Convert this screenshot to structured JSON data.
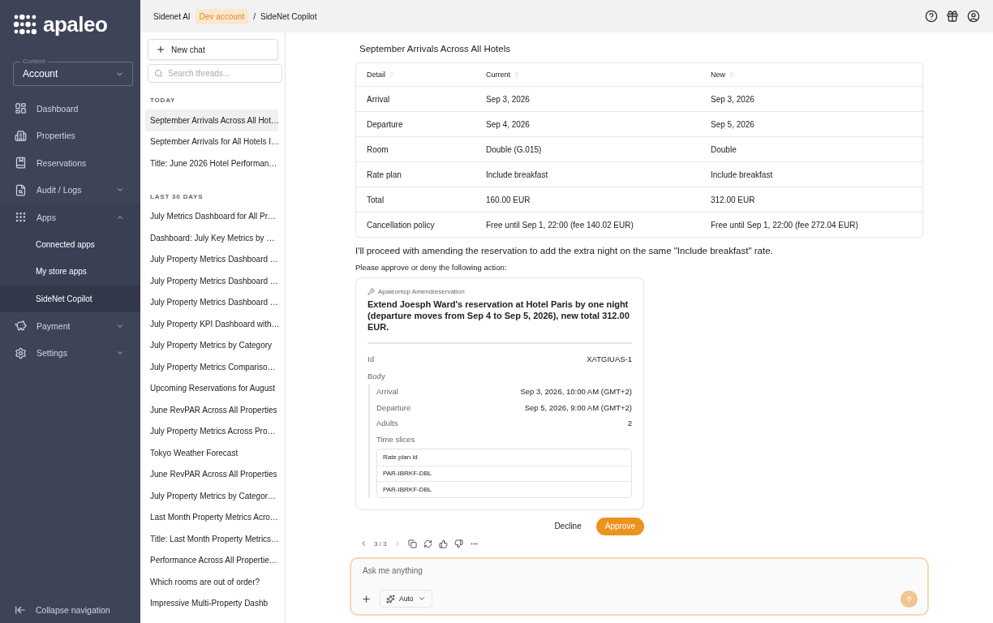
{
  "logo": {
    "text": "apaleo"
  },
  "context": {
    "label": "Context",
    "value": "Account"
  },
  "nav": [
    {
      "label": "Dashboard",
      "kind": "link"
    },
    {
      "label": "Properties",
      "kind": "link"
    },
    {
      "label": "Reservations",
      "kind": "link"
    },
    {
      "label": "Audit / Logs",
      "kind": "group",
      "expanded": false
    },
    {
      "label": "Apps",
      "kind": "group",
      "expanded": true,
      "children": [
        {
          "label": "Connected apps",
          "selected": false
        },
        {
          "label": "My store apps",
          "selected": false
        },
        {
          "label": "SideNet Copilot",
          "selected": true
        }
      ]
    },
    {
      "label": "Payment",
      "kind": "group",
      "expanded": false
    },
    {
      "label": "Settings",
      "kind": "group",
      "expanded": false
    }
  ],
  "collapse": {
    "label": "Collapse navigation"
  },
  "breadcrumb": [
    {
      "label": "Sidenet AI",
      "kind": "plain"
    },
    {
      "label": "Dev account",
      "kind": "badge"
    },
    {
      "label": "/",
      "kind": "separator"
    },
    {
      "label": "SideNet Copilot",
      "kind": "plain"
    }
  ],
  "threads": {
    "new_chat": "New chat",
    "search_placeholder": "Search threads...",
    "groups": [
      {
        "heading": "TODAY",
        "items": [
          {
            "title": "September Arrivals Across All Hot…",
            "selected": true
          },
          {
            "title": "September Arrivals for All Hotels I…",
            "selected": false
          },
          {
            "title": "Title: June 2026 Hotel Performan…",
            "selected": false
          }
        ]
      },
      {
        "heading": "LAST 30 DAYS",
        "items": [
          {
            "title": "July Metrics Dashboard for All Pr…",
            "selected": false
          },
          {
            "title": "Dashboard: July Key Metrics by …",
            "selected": false
          },
          {
            "title": "July Property Metrics Dashboard …",
            "selected": false
          },
          {
            "title": "July Property Metrics Dashboard …",
            "selected": false
          },
          {
            "title": "July Property Metrics Dashboard …",
            "selected": false
          },
          {
            "title": "July Property KPI Dashboard with…",
            "selected": false
          },
          {
            "title": "July Property Metrics by Category",
            "selected": false
          },
          {
            "title": "July Property Metrics Compariso…",
            "selected": false
          },
          {
            "title": "Upcoming Reservations for August",
            "selected": false
          },
          {
            "title": "June RevPAR Across All Properties",
            "selected": false
          },
          {
            "title": "July Property Metrics Across Pro…",
            "selected": false
          },
          {
            "title": "Tokyo Weather Forecast",
            "selected": false
          },
          {
            "title": "June RevPAR Across All Properties",
            "selected": false
          },
          {
            "title": "July Property Metrics by Categor…",
            "selected": false
          },
          {
            "title": "Last Month Property Metrics Acro…",
            "selected": false
          },
          {
            "title": "Title: Last Month Property Metrics…",
            "selected": false
          },
          {
            "title": "Performance Across All Propertie…",
            "selected": false
          },
          {
            "title": "Which rooms are out of order?",
            "selected": false
          },
          {
            "title": "Impressive Multi-Property Dashb",
            "selected": false
          }
        ]
      }
    ]
  },
  "message": {
    "table_title": "September Arrivals Across All Hotels",
    "columns": [
      "Detail",
      "Current",
      "New"
    ],
    "rows": [
      [
        "Arrival",
        "Sep 3, 2026",
        "Sep 3, 2026"
      ],
      [
        "Departure",
        "Sep 4, 2026",
        "Sep 5, 2026"
      ],
      [
        "Room",
        "Double (G.015)",
        "Double"
      ],
      [
        "Rate plan",
        "Include breakfast",
        "Include breakfast"
      ],
      [
        "Total",
        "160.00 EUR",
        "312.00 EUR"
      ],
      [
        "Cancellation policy",
        "Free until Sep 1, 22:00 (fee 140.02 EUR)",
        "Free until Sep 1, 22:00 (fee 272.04 EUR)"
      ]
    ],
    "text": "I'll proceed with amending the reservation to add the extra night on the same \"Include breakfast\" rate.",
    "prompt": "Please approve or deny the following action:"
  },
  "action_card": {
    "tool": "Apaleomcp Amendreservation",
    "summary": "Extend Joesph Ward's reservation at Hotel Paris by one night (departure moves from Sep 4 to Sep 5, 2026), new total 312.00 EUR.",
    "fields": [
      {
        "label": "Id",
        "value": "XATGIUAS-1"
      }
    ],
    "body_label": "Body",
    "body_fields": [
      {
        "label": "Arrival",
        "value": "Sep 3, 2026, 10:00 AM (GMT+2)"
      },
      {
        "label": "Departure",
        "value": "Sep 5, 2026, 9:00 AM (GMT+2)"
      },
      {
        "label": "Adults",
        "value": "2"
      }
    ],
    "slices_label": "Time slices",
    "slices_column": "Rate plan id",
    "slices": [
      "PAR-IBRKF-DBL",
      "PAR-IBRKF-DBL"
    ]
  },
  "actions": {
    "decline": "Decline",
    "approve": "Approve"
  },
  "pager": "3 / 3",
  "composer": {
    "placeholder": "Ask me anything",
    "mode": "Auto"
  }
}
